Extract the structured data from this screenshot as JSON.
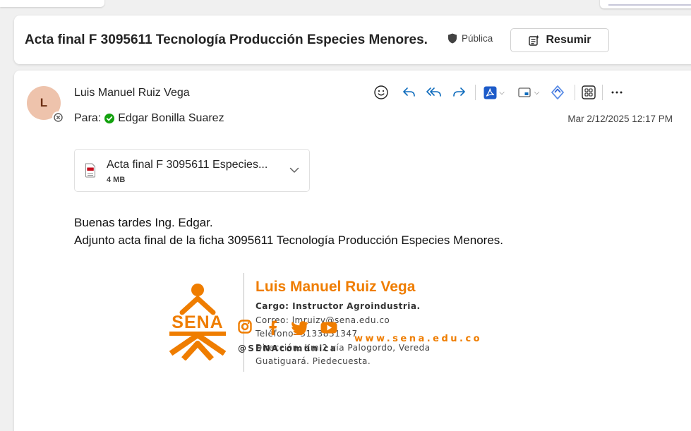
{
  "message": {
    "subject": "Acta final F 3095611  Tecnología Producción  Especies Menores.",
    "sensitivity_label": "Pública",
    "summarize_label": "Resumir",
    "sender": {
      "name": "Luis Manuel Ruiz Vega",
      "initial": "L"
    },
    "to_prefix": "Para:",
    "recipient": "Edgar Bonilla Suarez",
    "datetime": "Mar 2/12/2025 12:17 PM",
    "attachment": {
      "name": "Acta final F 3095611 Especies...",
      "size": "4 MB",
      "icon": "pdf-file-icon"
    },
    "body_lines": [
      "Buenas tardes Ing. Edgar.",
      "Adjunto acta final de la ficha 3095611 Tecnología Producción  Especies Menores."
    ]
  },
  "toolbar": {
    "icons": [
      "emoji-icon",
      "reply-icon",
      "reply-all-icon",
      "forward-icon",
      "pdf-icon",
      "immersive-reader-icon",
      "loop-icon",
      "apps-icon",
      "more-icon"
    ]
  },
  "signature": {
    "logo_text": "SENA",
    "name": "Luis Manuel Ruiz Vega",
    "role": "Cargo: Instructor Agroindustria.",
    "email": "Correo: lmruizv@sena.edu.co",
    "phone": "Teléfono- 3133831347",
    "address_1": "Dirección: Km 2 vía Palogordo, Vereda",
    "address_2": "Guatiguará. Piedecuesta.",
    "website": "www.sena.edu.co",
    "handle": "@SENAcomunica",
    "social_icons": [
      "instagram-icon",
      "facebook-icon",
      "twitter-icon",
      "youtube-icon"
    ]
  },
  "colors": {
    "accent": "#0f6cbd",
    "brand_orange": "#ef7d00",
    "presence_green": "#13a10e",
    "avatar_bg": "#eec3ac"
  }
}
